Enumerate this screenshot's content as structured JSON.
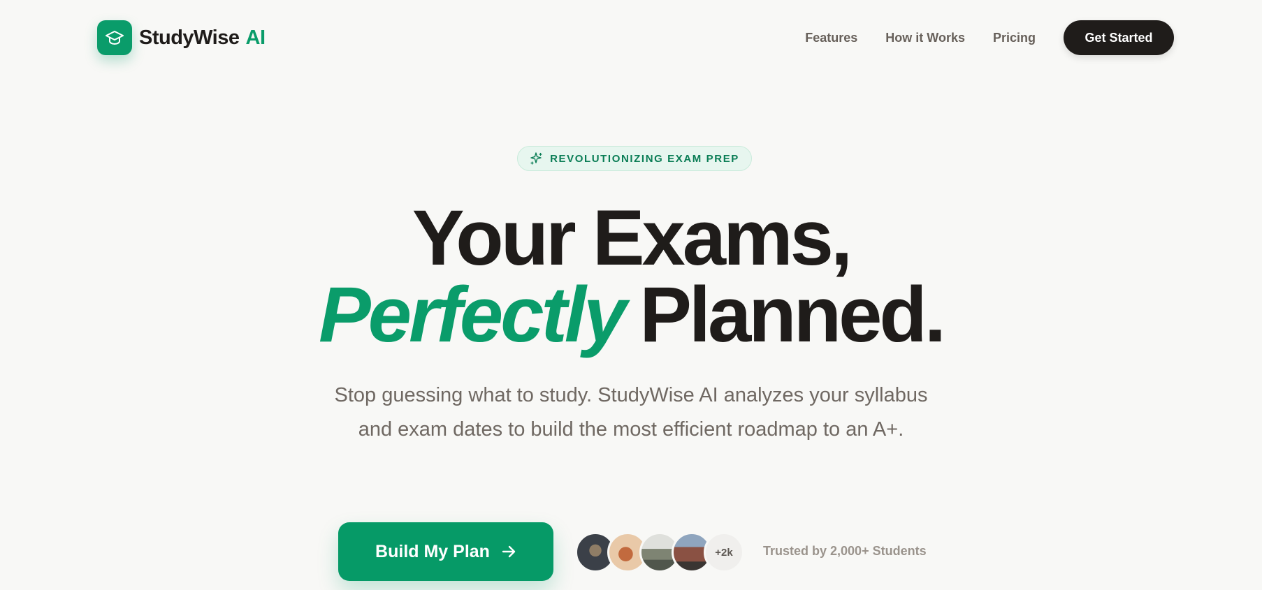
{
  "brand": {
    "name": "StudyWise",
    "suffix": "AI",
    "accent_color": "#0a9c6a"
  },
  "nav": {
    "links": [
      {
        "label": "Features"
      },
      {
        "label": "How it Works"
      },
      {
        "label": "Pricing"
      }
    ],
    "cta_label": "Get Started"
  },
  "hero": {
    "badge_icon": "sparkle-icon",
    "badge": "REVOLUTIONIZING EXAM PREP",
    "headline_line1": "Your Exams,",
    "headline_accent": "Perfectly",
    "headline_line2_rest": "Planned.",
    "subtext": "Stop guessing what to study. StudyWise AI analyzes your syllabus and exam dates to build the most efficient roadmap to an A+.",
    "cta_label": "Build My Plan",
    "cta_icon": "arrow-right-icon",
    "avatar_more": "+2k",
    "trusted_text": "Trusted by 2,000+ Students"
  },
  "colors": {
    "primary": "#069a67",
    "dark": "#1f1c1a",
    "background": "#f8f8f6"
  }
}
